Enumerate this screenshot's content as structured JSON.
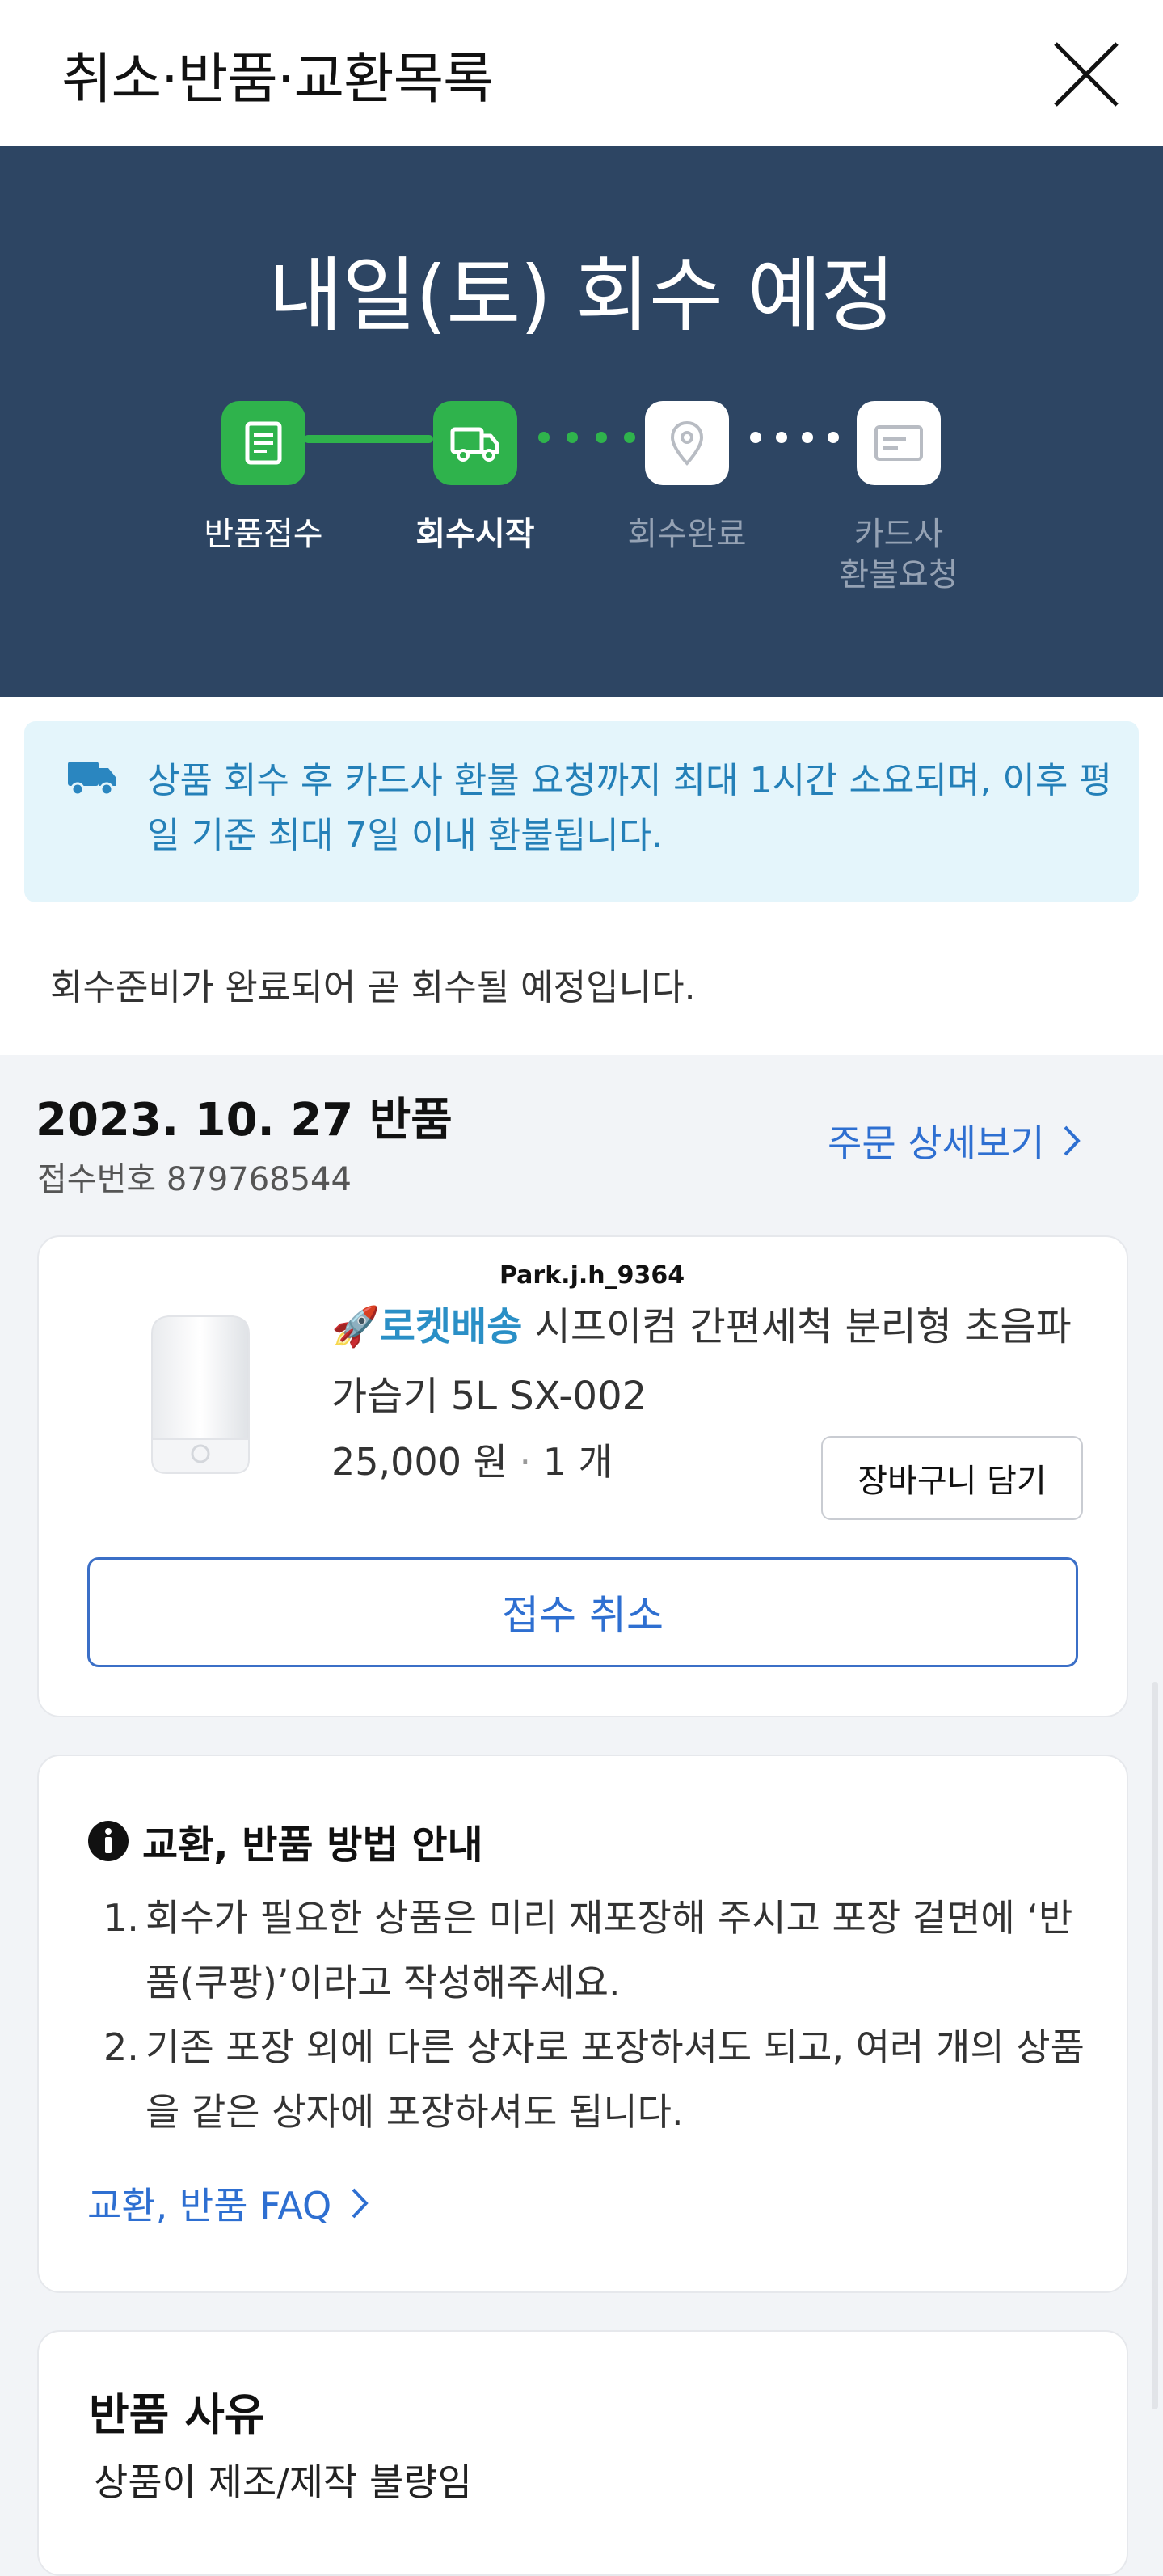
{
  "header": {
    "title": "취소·반품·교환목록",
    "close_icon": "close-icon"
  },
  "hero": {
    "headline": "내일(토) 회수 예정",
    "steps": [
      {
        "label": "반품접수",
        "icon": "receipt-icon",
        "state": "done"
      },
      {
        "label": "회수시작",
        "icon": "truck-icon",
        "state": "current"
      },
      {
        "label": "회수완료",
        "icon": "location-pin-icon",
        "state": "pending"
      },
      {
        "label": "카드사\n환불요청",
        "icon": "card-icon",
        "state": "pending"
      }
    ],
    "colors": {
      "background": "#2d4563",
      "active": "#2fb34c"
    }
  },
  "notice": {
    "icon": "delivery-truck-icon",
    "text": "상품 회수 후 카드사 환불 요청까지 최대 1시간 소요되며, 이후 평일 기준 최대 7일 이내 환불됩니다."
  },
  "status_message": "회수준비가 완료되어 곧 회수될 예정입니다.",
  "order": {
    "date_label": "2023. 10. 27 반품",
    "receipt_label": "접수번호 879768544",
    "detail_link": "주문 상세보기"
  },
  "product": {
    "watermark": "Park.j.h_9364",
    "badge": "로켓배송",
    "name": "시프이컴 간편세척 분리형 초음파 가습기 5L SX-002",
    "price": "25,000 원",
    "separator": "·",
    "quantity": "1 개",
    "cart_button": "장바구니 담기",
    "cancel_button": "접수 취소"
  },
  "guide": {
    "title": "교환, 반품 방법 안내",
    "items": [
      {
        "num": "1.",
        "text": "회수가 필요한 상품은 미리 재포장해 주시고 포장 겉면에 ‘반품(쿠팡)’이라고 작성해주세요."
      },
      {
        "num": "2.",
        "text": "기존 포장 외에 다른 상자로 포장하셔도 되고, 여러 개의 상품을 같은 상자에 포장하셔도 됩니다."
      }
    ],
    "faq_link": "교환, 반품 FAQ"
  },
  "reason": {
    "title": "반품 사유",
    "text": "상품이 제조/제작 불량임"
  }
}
